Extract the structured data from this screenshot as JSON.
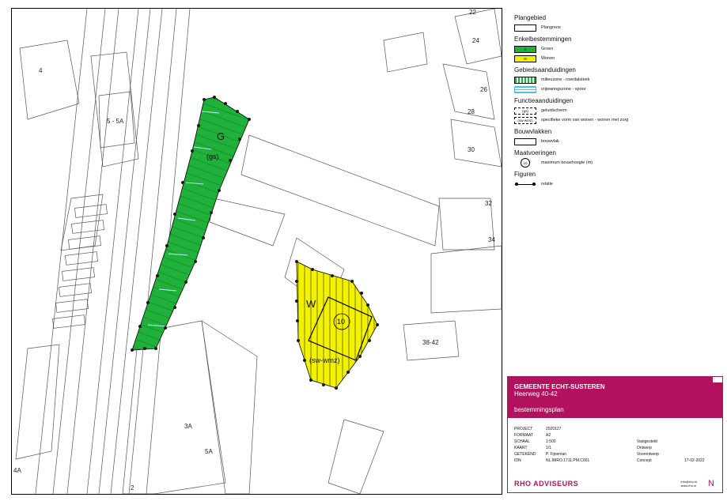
{
  "map": {
    "house_numbers": [
      "22",
      "24",
      "26",
      "28",
      "30",
      "32",
      "34",
      "38-42",
      "3A",
      "4",
      "4A",
      "5 - 5A",
      "5A",
      "2"
    ],
    "zone_labels": {
      "groen": "G",
      "groen_function": "(gs)",
      "wonen": "W",
      "wonen_function": "(sw-wmz)",
      "height": "10"
    }
  },
  "legend": {
    "sections": [
      {
        "heading": "Plangebied",
        "items": [
          {
            "label": "Plangrens",
            "swatch": "plangrens"
          }
        ]
      },
      {
        "heading": "Enkelbestemmingen",
        "items": [
          {
            "label": "Groen",
            "code": "G",
            "swatch": "groen"
          },
          {
            "label": "Wonen",
            "code": "W",
            "swatch": "wonen"
          }
        ]
      },
      {
        "heading": "Gebiedsaanduidingen",
        "items": [
          {
            "label": "milieuzone - roerdalsteek",
            "swatch": "milieu"
          },
          {
            "label": "vrijwaringszone - spoor",
            "swatch": "vrijwaring"
          }
        ]
      },
      {
        "heading": "Functieaanduidingen",
        "items": [
          {
            "label": "geluidscherm",
            "code": "(gs)",
            "swatch": "dashed"
          },
          {
            "label": "specifieke vorm van wonen - wonen met zorg",
            "code": "(sw-wmz)",
            "swatch": "dashed"
          }
        ]
      },
      {
        "heading": "Bouwvlakken",
        "items": [
          {
            "label": "bouwvlak",
            "swatch": "bouwvlak"
          }
        ]
      },
      {
        "heading": "Maatvoeringen",
        "items": [
          {
            "label": "maximum bouwhoogte (m)",
            "code": "10",
            "swatch": "height"
          }
        ]
      },
      {
        "heading": "Figuren",
        "items": [
          {
            "label": "relatie",
            "swatch": "relatie"
          }
        ]
      }
    ]
  },
  "titleblock": {
    "municipality": "GEMEENTE ECHT-SUSTEREN",
    "address": "Heerweg 40-42",
    "plan_type": "bestemmingsplan",
    "rows": [
      {
        "key": "PROJECT",
        "value": "2020127",
        "status": "",
        "date": ""
      },
      {
        "key": "FORMAAT",
        "value": "A2",
        "status": "",
        "date": ""
      },
      {
        "key": "SCHAAL",
        "value": "1:500",
        "status": "Vastgesteld",
        "date": ""
      },
      {
        "key": "KAART",
        "value": "1/1",
        "status": "Ontwerp",
        "date": ""
      },
      {
        "key": "GETEKEND",
        "value": "P. Fijneman",
        "status": "Voorontwerp",
        "date": ""
      },
      {
        "key": "IDN",
        "value": "NL.IMRO.1711.PM.C001",
        "status": "Concept",
        "date": "17-02-2022"
      }
    ],
    "brand": "RHO ADVISEURS",
    "contact": [
      "info@rho.nl",
      "www.rho.nl"
    ],
    "north": "N"
  },
  "colors": {
    "groen": "#1fb13a",
    "wonen": "#f2f200",
    "brand": "#b2125d",
    "vrijwaring": "#41c8e6"
  }
}
